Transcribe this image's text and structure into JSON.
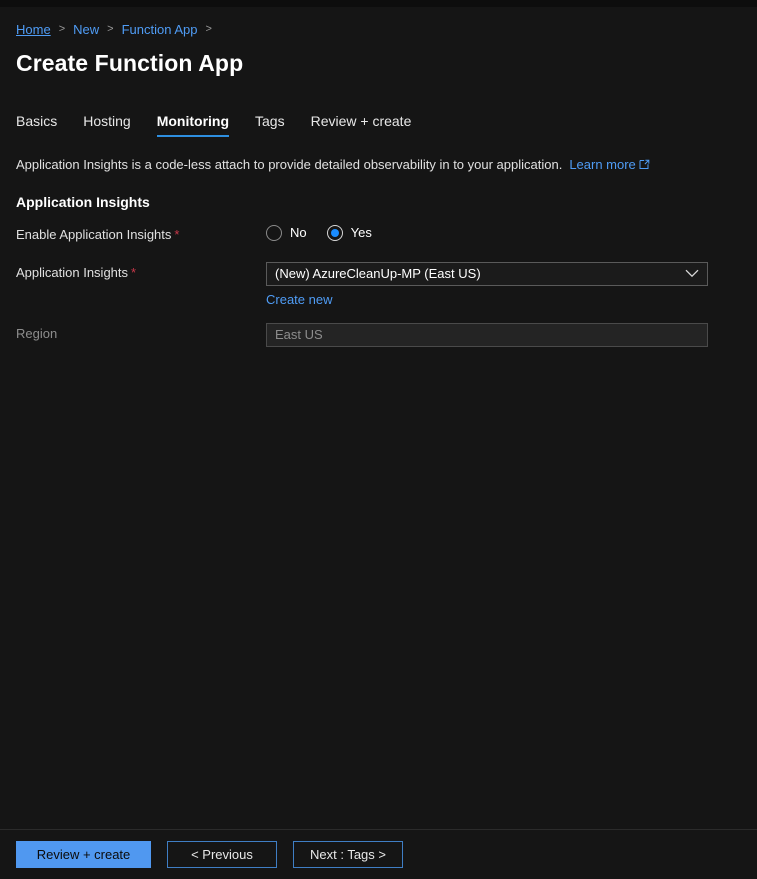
{
  "breadcrumb": {
    "items": [
      {
        "label": "Home",
        "sep": ">"
      },
      {
        "label": "New",
        "sep": ">"
      },
      {
        "label": "Function App",
        "sep": ">"
      }
    ]
  },
  "page": {
    "title": "Create Function App"
  },
  "tabs": [
    {
      "label": "Basics",
      "active": false
    },
    {
      "label": "Hosting",
      "active": false
    },
    {
      "label": "Monitoring",
      "active": true
    },
    {
      "label": "Tags",
      "active": false
    },
    {
      "label": "Review + create",
      "active": false
    }
  ],
  "description": {
    "text": "Application Insights is a code-less attach to provide detailed observability in to your application.",
    "link_label": "Learn more",
    "link_icon": "external-link-icon"
  },
  "section": {
    "heading": "Application Insights"
  },
  "fields": {
    "enable_app_insights": {
      "label": "Enable Application Insights",
      "required": "*",
      "options": [
        {
          "label": "No",
          "selected": false
        },
        {
          "label": "Yes",
          "selected": true
        }
      ]
    },
    "app_insights": {
      "label": "Application Insights",
      "required": "*",
      "value": "(New) AzureCleanUp-MP (East US)",
      "icon": "chevron-down-icon",
      "create_new_label": "Create new"
    },
    "region": {
      "label": "Region",
      "value": "East US",
      "placeholder": "East US",
      "disabled": true
    }
  },
  "footer": {
    "review_create_label": "Review + create",
    "previous_label": "< Previous",
    "next_label": "Next : Tags >"
  },
  "colors": {
    "accent": "#5098f0",
    "link": "#4f9cf5",
    "required": "#c9384a",
    "tab_underline": "#2e8fe0",
    "radio_selected": "#1a8cff",
    "background": "#151515"
  }
}
